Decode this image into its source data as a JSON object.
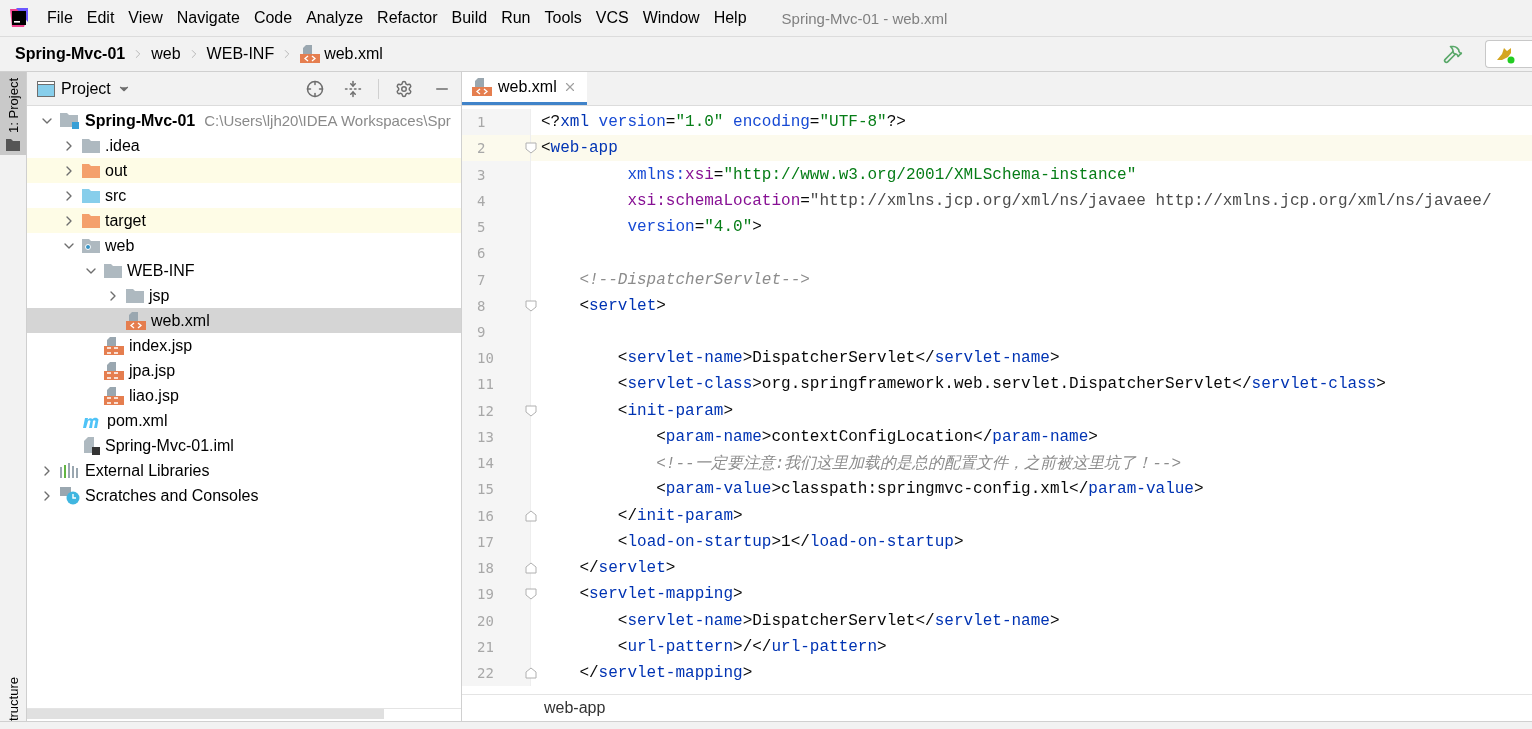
{
  "window": {
    "title": "Spring-Mvc-01 - web.xml"
  },
  "menu": [
    "File",
    "Edit",
    "View",
    "Navigate",
    "Code",
    "Analyze",
    "Refactor",
    "Build",
    "Run",
    "Tools",
    "VCS",
    "Window",
    "Help"
  ],
  "breadcrumbs": [
    {
      "label": "Spring-Mvc-01",
      "kind": "project"
    },
    {
      "label": "web",
      "kind": "folder"
    },
    {
      "label": "WEB-INF",
      "kind": "folder"
    },
    {
      "label": "web.xml",
      "kind": "xml"
    }
  ],
  "side_tabs": [
    {
      "label": "1: Project",
      "selected": true
    },
    {
      "label": "tructure",
      "selected": false
    }
  ],
  "project_panel": {
    "title": "Project",
    "tree": [
      {
        "label": "Spring-Mvc-01",
        "path": "C:\\Users\\ljh20\\IDEA Workspaces\\Spr",
        "kind": "module",
        "expanded": true,
        "selected": false,
        "excluded": false,
        "children": [
          {
            "label": ".idea",
            "kind": "folder",
            "expanded": false,
            "selected": false,
            "excluded": false
          },
          {
            "label": "out",
            "kind": "folder",
            "expanded": false,
            "selected": false,
            "excluded": true
          },
          {
            "label": "src",
            "kind": "source",
            "expanded": false,
            "selected": false,
            "excluded": false
          },
          {
            "label": "target",
            "kind": "folder",
            "expanded": false,
            "selected": false,
            "excluded": true
          },
          {
            "label": "web",
            "kind": "web",
            "expanded": true,
            "selected": false,
            "excluded": false,
            "children": [
              {
                "label": "WEB-INF",
                "kind": "folder",
                "expanded": true,
                "selected": false,
                "excluded": false,
                "children": [
                  {
                    "label": "jsp",
                    "kind": "folder",
                    "expanded": false,
                    "selected": false,
                    "excluded": false
                  },
                  {
                    "label": "web.xml",
                    "kind": "xml",
                    "selected": true,
                    "excluded": false
                  }
                ]
              },
              {
                "label": "index.jsp",
                "kind": "jsp",
                "selected": false,
                "excluded": false
              },
              {
                "label": "jpa.jsp",
                "kind": "jsp",
                "selected": false,
                "excluded": false
              },
              {
                "label": "liao.jsp",
                "kind": "jsp",
                "selected": false,
                "excluded": false
              }
            ]
          },
          {
            "label": "pom.xml",
            "kind": "maven",
            "selected": false,
            "excluded": false
          },
          {
            "label": "Spring-Mvc-01.iml",
            "kind": "iml",
            "selected": false,
            "excluded": false
          }
        ]
      },
      {
        "label": "External Libraries",
        "kind": "libraries",
        "expanded": false,
        "selected": false,
        "excluded": false
      },
      {
        "label": "Scratches and Consoles",
        "kind": "scratches",
        "expanded": false,
        "selected": false,
        "excluded": false
      }
    ]
  },
  "editor": {
    "tabs": [
      {
        "label": "web.xml",
        "selected": true
      }
    ],
    "lines": [
      {
        "number": "1",
        "current": false,
        "tokens": [
          {
            "kind": "p",
            "text": "<?"
          },
          {
            "kind": "tag",
            "text": "xml "
          },
          {
            "kind": "attr",
            "text": "version"
          },
          {
            "kind": "p",
            "text": "="
          },
          {
            "kind": "str",
            "text": "\"1.0\" "
          },
          {
            "kind": "attr",
            "text": "encoding"
          },
          {
            "kind": "p",
            "text": "="
          },
          {
            "kind": "str",
            "text": "\"UTF-8\""
          },
          {
            "kind": "p",
            "text": "?>"
          }
        ]
      },
      {
        "number": "2",
        "current": true,
        "fold_start": true,
        "tokens": [
          {
            "kind": "p",
            "text": "<"
          },
          {
            "kind": "tag",
            "text": "web-app"
          }
        ]
      },
      {
        "number": "3",
        "current": false,
        "tokens": [
          {
            "kind": "attr",
            "text": "         xmlns:"
          },
          {
            "kind": "ns",
            "text": "xsi"
          },
          {
            "kind": "p",
            "text": "="
          },
          {
            "kind": "str",
            "text": "\"http://www.w3.org/2001/XMLSchema-instance\""
          }
        ]
      },
      {
        "number": "4",
        "current": false,
        "tokens": [
          {
            "kind": "ns",
            "text": "         xsi:schemaLocation"
          },
          {
            "kind": "p",
            "text": "="
          },
          {
            "kind": "url",
            "text": "\"http://xmlns.jcp.org/xml/ns/javaee http://xmlns.jcp.org/xml/ns/javaee/"
          }
        ]
      },
      {
        "number": "5",
        "current": false,
        "tokens": [
          {
            "kind": "attr",
            "text": "         version"
          },
          {
            "kind": "p",
            "text": "="
          },
          {
            "kind": "str",
            "text": "\"4.0\""
          },
          {
            "kind": "p",
            "text": ">"
          }
        ]
      },
      {
        "number": "6",
        "current": false
      },
      {
        "number": "7",
        "current": false,
        "tokens": [
          {
            "kind": "cm",
            "text": "    <!--DispatcherServlet-->"
          }
        ]
      },
      {
        "number": "8",
        "current": false,
        "fold_start": true,
        "tokens": [
          {
            "kind": "p",
            "text": "    <"
          },
          {
            "kind": "tag",
            "text": "servlet"
          },
          {
            "kind": "p",
            "text": ">"
          }
        ]
      },
      {
        "number": "9",
        "current": false
      },
      {
        "number": "10",
        "current": false,
        "tokens": [
          {
            "kind": "p",
            "text": "        <"
          },
          {
            "kind": "tag",
            "text": "servlet-name"
          },
          {
            "kind": "p",
            "text": ">DispatcherServlet</"
          },
          {
            "kind": "tag",
            "text": "servlet-name"
          },
          {
            "kind": "p",
            "text": ">"
          }
        ]
      },
      {
        "number": "11",
        "current": false,
        "tokens": [
          {
            "kind": "p",
            "text": "        <"
          },
          {
            "kind": "tag",
            "text": "servlet-class"
          },
          {
            "kind": "p",
            "text": ">org.springframework.web.servlet.DispatcherServlet</"
          },
          {
            "kind": "tag",
            "text": "servlet-class"
          },
          {
            "kind": "p",
            "text": ">"
          }
        ]
      },
      {
        "number": "12",
        "current": false,
        "fold_start": true,
        "tokens": [
          {
            "kind": "p",
            "text": "        <"
          },
          {
            "kind": "tag",
            "text": "init-param"
          },
          {
            "kind": "p",
            "text": ">"
          }
        ]
      },
      {
        "number": "13",
        "current": false,
        "tokens": [
          {
            "kind": "p",
            "text": "            <"
          },
          {
            "kind": "tag",
            "text": "param-name"
          },
          {
            "kind": "p",
            "text": ">contextConfigLocation</"
          },
          {
            "kind": "tag",
            "text": "param-name"
          },
          {
            "kind": "p",
            "text": ">"
          }
        ]
      },
      {
        "number": "14",
        "current": false,
        "tokens": [
          {
            "kind": "cm",
            "text": "            <!--一定要注意:我们这里加载的是总的配置文件，之前被这里坑了！-->"
          }
        ]
      },
      {
        "number": "15",
        "current": false,
        "tokens": [
          {
            "kind": "p",
            "text": "            <"
          },
          {
            "kind": "tag",
            "text": "param-value"
          },
          {
            "kind": "p",
            "text": ">classpath:springmvc-config.xml</"
          },
          {
            "kind": "tag",
            "text": "param-value"
          },
          {
            "kind": "p",
            "text": ">"
          }
        ]
      },
      {
        "number": "16",
        "current": false,
        "fold_end": true,
        "tokens": [
          {
            "kind": "p",
            "text": "        </"
          },
          {
            "kind": "tag",
            "text": "init-param"
          },
          {
            "kind": "p",
            "text": ">"
          }
        ]
      },
      {
        "number": "17",
        "current": false,
        "tokens": [
          {
            "kind": "p",
            "text": "        <"
          },
          {
            "kind": "tag",
            "text": "load-on-startup"
          },
          {
            "kind": "p",
            "text": ">1</"
          },
          {
            "kind": "tag",
            "text": "load-on-startup"
          },
          {
            "kind": "p",
            "text": ">"
          }
        ]
      },
      {
        "number": "18",
        "current": false,
        "fold_end": true,
        "tokens": [
          {
            "kind": "p",
            "text": "    </"
          },
          {
            "kind": "tag",
            "text": "servlet"
          },
          {
            "kind": "p",
            "text": ">"
          }
        ]
      },
      {
        "number": "19",
        "current": false,
        "fold_start": true,
        "tokens": [
          {
            "kind": "p",
            "text": "    <"
          },
          {
            "kind": "tag",
            "text": "servlet-mapping"
          },
          {
            "kind": "p",
            "text": ">"
          }
        ]
      },
      {
        "number": "20",
        "current": false,
        "tokens": [
          {
            "kind": "p",
            "text": "        <"
          },
          {
            "kind": "tag",
            "text": "servlet-name"
          },
          {
            "kind": "p",
            "text": ">DispatcherServlet</"
          },
          {
            "kind": "tag",
            "text": "servlet-name"
          },
          {
            "kind": "p",
            "text": ">"
          }
        ]
      },
      {
        "number": "21",
        "current": false,
        "tokens": [
          {
            "kind": "p",
            "text": "        <"
          },
          {
            "kind": "tag",
            "text": "url-pattern"
          },
          {
            "kind": "p",
            "text": ">/</"
          },
          {
            "kind": "tag",
            "text": "url-pattern"
          },
          {
            "kind": "p",
            "text": ">"
          }
        ]
      },
      {
        "number": "22",
        "current": false,
        "fold_end": true,
        "tokens": [
          {
            "kind": "p",
            "text": "    </"
          },
          {
            "kind": "tag",
            "text": "servlet-mapping"
          },
          {
            "kind": "p",
            "text": ">"
          }
        ]
      }
    ],
    "breadcrumb": "web-app"
  }
}
